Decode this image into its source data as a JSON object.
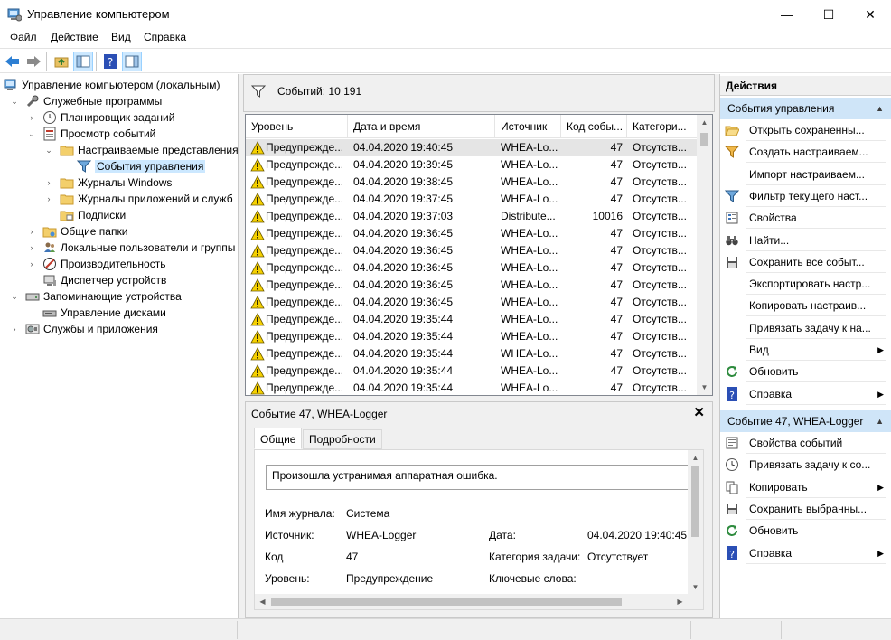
{
  "window": {
    "title": "Управление компьютером",
    "minimize": "—",
    "maximize": "☐",
    "close": "✕"
  },
  "menu": {
    "items": [
      {
        "label": "Файл"
      },
      {
        "label": "Действие"
      },
      {
        "label": "Вид"
      },
      {
        "label": "Справка"
      }
    ]
  },
  "toolbar": {
    "buttons": [
      "back-icon",
      "forward-icon",
      "up-folder-icon",
      "show-hide-tree-icon",
      "help-icon",
      "show-action-pane-icon"
    ]
  },
  "tree": {
    "items": [
      {
        "label": "Управление компьютером (локальным)",
        "icon": "computer-icon",
        "expander": "",
        "level": 0
      },
      {
        "label": "Служебные программы",
        "icon": "tools-icon",
        "expander": "⌄",
        "level": 1
      },
      {
        "label": "Планировщик заданий",
        "icon": "clock-icon",
        "expander": "›",
        "level": 2
      },
      {
        "label": "Просмотр событий",
        "icon": "event-viewer-icon",
        "expander": "⌄",
        "level": 2
      },
      {
        "label": "Настраиваемые представления",
        "icon": "folder-icon",
        "expander": "⌄",
        "level": 3
      },
      {
        "label": "События управления",
        "icon": "filter-icon",
        "expander": "",
        "level": 4,
        "selected": true
      },
      {
        "label": "Журналы Windows",
        "icon": "folder-icon",
        "expander": "›",
        "level": 3
      },
      {
        "label": "Журналы приложений и служб",
        "icon": "folder-icon",
        "expander": "›",
        "level": 3
      },
      {
        "label": "Подписки",
        "icon": "subscriptions-icon",
        "expander": "",
        "level": 3
      },
      {
        "label": "Общие папки",
        "icon": "shared-folder-icon",
        "expander": "›",
        "level": 2
      },
      {
        "label": "Локальные пользователи и группы",
        "icon": "users-icon",
        "expander": "›",
        "level": 2
      },
      {
        "label": "Производительность",
        "icon": "performance-icon",
        "expander": "›",
        "level": 2
      },
      {
        "label": "Диспетчер устройств",
        "icon": "device-manager-icon",
        "expander": "",
        "level": 2
      },
      {
        "label": "Запоминающие устройства",
        "icon": "storage-icon",
        "expander": "⌄",
        "level": 1
      },
      {
        "label": "Управление дисками",
        "icon": "disk-icon",
        "expander": "",
        "level": 2
      },
      {
        "label": "Службы и приложения",
        "icon": "services-icon",
        "expander": "›",
        "level": 1
      }
    ]
  },
  "events_header": {
    "count_label": "Событий: 10 191"
  },
  "events_table": {
    "columns": [
      "Уровень",
      "Дата и время",
      "Источник",
      "Код собы...",
      "Категори..."
    ],
    "rows": [
      [
        "Предупрежде...",
        "04.04.2020 19:40:45",
        "WHEA-Lo...",
        "47",
        "Отсутств..."
      ],
      [
        "Предупрежде...",
        "04.04.2020 19:39:45",
        "WHEA-Lo...",
        "47",
        "Отсутств..."
      ],
      [
        "Предупрежде...",
        "04.04.2020 19:38:45",
        "WHEA-Lo...",
        "47",
        "Отсутств..."
      ],
      [
        "Предупрежде...",
        "04.04.2020 19:37:45",
        "WHEA-Lo...",
        "47",
        "Отсутств..."
      ],
      [
        "Предупрежде...",
        "04.04.2020 19:37:03",
        "Distribute...",
        "10016",
        "Отсутств..."
      ],
      [
        "Предупрежде...",
        "04.04.2020 19:36:45",
        "WHEA-Lo...",
        "47",
        "Отсутств..."
      ],
      [
        "Предупрежде...",
        "04.04.2020 19:36:45",
        "WHEA-Lo...",
        "47",
        "Отсутств..."
      ],
      [
        "Предупрежде...",
        "04.04.2020 19:36:45",
        "WHEA-Lo...",
        "47",
        "Отсутств..."
      ],
      [
        "Предупрежде...",
        "04.04.2020 19:36:45",
        "WHEA-Lo...",
        "47",
        "Отсутств..."
      ],
      [
        "Предупрежде...",
        "04.04.2020 19:36:45",
        "WHEA-Lo...",
        "47",
        "Отсутств..."
      ],
      [
        "Предупрежде...",
        "04.04.2020 19:35:44",
        "WHEA-Lo...",
        "47",
        "Отсутств..."
      ],
      [
        "Предупрежде...",
        "04.04.2020 19:35:44",
        "WHEA-Lo...",
        "47",
        "Отсутств..."
      ],
      [
        "Предупрежде...",
        "04.04.2020 19:35:44",
        "WHEA-Lo...",
        "47",
        "Отсутств..."
      ],
      [
        "Предупрежде...",
        "04.04.2020 19:35:44",
        "WHEA-Lo...",
        "47",
        "Отсутств..."
      ],
      [
        "Предупрежде...",
        "04.04.2020 19:35:44",
        "WHEA-Lo...",
        "47",
        "Отсутств..."
      ]
    ]
  },
  "detail": {
    "title": "Событие 47, WHEA-Logger",
    "close": "✕",
    "tabs": [
      "Общие",
      "Подробности"
    ],
    "message": "Произошла устранимая аппаратная ошибка.",
    "fields": {
      "log_name_label": "Имя журнала:",
      "log_name": "Система",
      "source_label": "Источник:",
      "source": "WHEA-Logger",
      "date_label": "Дата:",
      "date": "04.04.2020 19:40:45",
      "code_label": "Код",
      "code": "47",
      "task_label": "Категория задачи:",
      "task": "Отсутствует",
      "level_label": "Уровень:",
      "level": "Предупреждение",
      "keywords_label": "Ключевые слова:"
    }
  },
  "actions": {
    "title": "Действия",
    "section1": {
      "label": "События управления",
      "items": [
        {
          "label": "Открыть сохраненны...",
          "icon": "open-folder-icon",
          "submenu": ""
        },
        {
          "label": "Создать настраиваем...",
          "icon": "create-filter-icon",
          "submenu": ""
        },
        {
          "label": "Импорт настраиваем...",
          "icon": "",
          "submenu": ""
        },
        {
          "label": "Фильтр текущего наст...",
          "icon": "filter-icon",
          "submenu": ""
        },
        {
          "label": "Свойства",
          "icon": "properties-icon",
          "submenu": ""
        },
        {
          "label": "Найти...",
          "icon": "binoculars-icon",
          "submenu": ""
        },
        {
          "label": "Сохранить все событ...",
          "icon": "save-icon",
          "submenu": ""
        },
        {
          "label": "Экспортировать настр...",
          "icon": "",
          "submenu": ""
        },
        {
          "label": "Копировать настраив...",
          "icon": "",
          "submenu": ""
        },
        {
          "label": "Привязать задачу к на...",
          "icon": "",
          "submenu": ""
        },
        {
          "label": "Вид",
          "icon": "",
          "submenu": "▶"
        },
        {
          "label": "Обновить",
          "icon": "refresh-icon",
          "submenu": ""
        },
        {
          "label": "Справка",
          "icon": "help-icon",
          "submenu": "▶"
        }
      ]
    },
    "section2": {
      "label": "Событие 47, WHEA-Logger",
      "items": [
        {
          "label": "Свойства событий",
          "icon": "event-properties-icon",
          "submenu": ""
        },
        {
          "label": "Привязать задачу к со...",
          "icon": "attach-task-icon",
          "submenu": ""
        },
        {
          "label": "Копировать",
          "icon": "copy-icon",
          "submenu": "▶"
        },
        {
          "label": "Сохранить выбранны...",
          "icon": "save-icon",
          "submenu": ""
        },
        {
          "label": "Обновить",
          "icon": "refresh-icon",
          "submenu": ""
        },
        {
          "label": "Справка",
          "icon": "help-icon",
          "submenu": "▶"
        }
      ]
    }
  },
  "colors": {
    "selection": "#cce8ff",
    "section_header": "#cfe5f8",
    "warning": "#f5d000",
    "panel": "#f0f0f0"
  }
}
